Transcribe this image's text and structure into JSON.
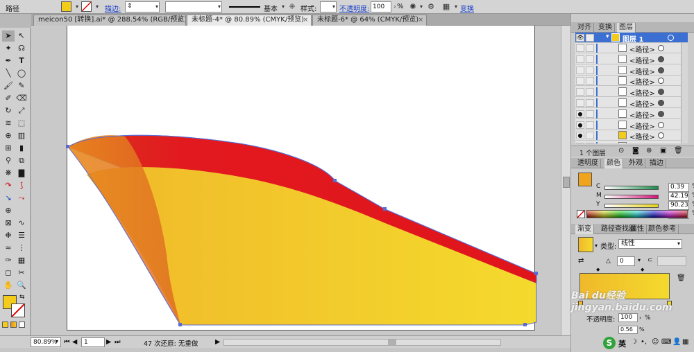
{
  "control_bar": {
    "object_type": "路径",
    "fill_color": "#f3cc1b",
    "stroke_label": "描边:",
    "stroke_weight": "",
    "brush_profile": "基本",
    "style_label": "样式:",
    "opacity_label": "不透明度:",
    "opacity_value": "100",
    "opacity_unit": "%",
    "transform_link": "变换"
  },
  "tabs": [
    {
      "label": "meicon50 [转换].ai* @ 288.54% (RGB/预览)",
      "active": false
    },
    {
      "label": "未标题-4* @ 80.89% (CMYK/预览)",
      "active": true
    },
    {
      "label": "未标题-6* @ 64% (CMYK/预览)",
      "active": false
    }
  ],
  "status": {
    "zoom": "80.89%",
    "page": "1",
    "undo_text": "47 次还原: 无重做"
  },
  "panels": {
    "top_tabs": [
      "对齐",
      "变换",
      "图层"
    ],
    "layer_name": "图层 1",
    "layer_items": [
      "<路径>",
      "<路径>",
      "<路径>",
      "<路径>",
      "<路径>",
      "<路径>",
      "<路径>",
      "<路径>",
      "<路径>",
      "<路径>"
    ],
    "layer_count": "1 个图层",
    "color_tabs": [
      "透明度",
      "颜色",
      "外观",
      "描边"
    ],
    "cmyk": [
      {
        "ch": "C",
        "value": "0.39",
        "color": "#1c8c4c"
      },
      {
        "ch": "M",
        "value": "42.19",
        "color": "#d4127a"
      },
      {
        "ch": "Y",
        "value": "90.23",
        "color": "#e6d21c"
      },
      {
        "ch": "K",
        "value": "0",
        "color": "#222222"
      }
    ],
    "percent": "%",
    "gradient_tabs": [
      "渐变",
      "路径查找器",
      "属性",
      "颜色参考"
    ],
    "gradient_type_label": "类型:",
    "gradient_type": "线性",
    "gradient_angle": "0",
    "gradient_opacity_label": "不透明度:",
    "gradient_opacity": "100",
    "gradient_location": "0.56"
  },
  "watermark": "Bai du经验 jingyan.baidu.com",
  "colors": {
    "accent": "#3b6fd2",
    "yellow": "#f3cc1b",
    "orange": "#e98b1f",
    "red": "#e2191f"
  },
  "ime_label": "英"
}
